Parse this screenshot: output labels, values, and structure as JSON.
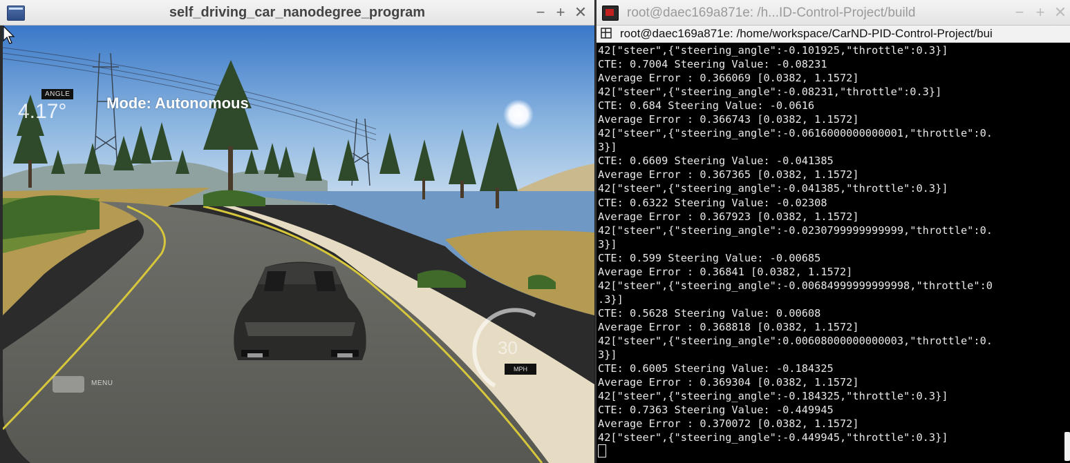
{
  "simulator": {
    "title": "self_driving_car_nanodegree_program",
    "controls": {
      "minimize": "−",
      "maximize": "+",
      "close": "✕"
    },
    "hud": {
      "angle_label": "ANGLE",
      "angle_value": "4.17°",
      "mode": "Mode: Autonomous",
      "menu_label": "MENU",
      "speed_value": "30",
      "speed_unit": "MPH"
    }
  },
  "terminal": {
    "title": "root@daec169a871e: /h...ID-Control-Project/build",
    "controls": {
      "minimize": "−",
      "maximize": "+",
      "close": "✕"
    },
    "tab_label": "root@daec169a871e: /home/workspace/CarND-PID-Control-Project/bui",
    "lines": [
      "42[\"steer\",{\"steering_angle\":-0.101925,\"throttle\":0.3}]",
      "CTE: 0.7004 Steering Value: -0.08231",
      "Average Error : 0.366069 [0.0382, 1.1572]",
      "42[\"steer\",{\"steering_angle\":-0.08231,\"throttle\":0.3}]",
      "CTE: 0.684 Steering Value: -0.0616",
      "Average Error : 0.366743 [0.0382, 1.1572]",
      "42[\"steer\",{\"steering_angle\":-0.0616000000000001,\"throttle\":0.",
      "3}]",
      "CTE: 0.6609 Steering Value: -0.041385",
      "Average Error : 0.367365 [0.0382, 1.1572]",
      "42[\"steer\",{\"steering_angle\":-0.041385,\"throttle\":0.3}]",
      "CTE: 0.6322 Steering Value: -0.02308",
      "Average Error : 0.367923 [0.0382, 1.1572]",
      "42[\"steer\",{\"steering_angle\":-0.0230799999999999,\"throttle\":0.",
      "3}]",
      "CTE: 0.599 Steering Value: -0.00685",
      "Average Error : 0.36841 [0.0382, 1.1572]",
      "42[\"steer\",{\"steering_angle\":-0.00684999999999998,\"throttle\":0",
      ".3}]",
      "CTE: 0.5628 Steering Value: 0.00608",
      "Average Error : 0.368818 [0.0382, 1.1572]",
      "42[\"steer\",{\"steering_angle\":0.00608000000000003,\"throttle\":0.",
      "3}]",
      "CTE: 0.6005 Steering Value: -0.184325",
      "Average Error : 0.369304 [0.0382, 1.1572]",
      "42[\"steer\",{\"steering_angle\":-0.184325,\"throttle\":0.3}]",
      "CTE: 0.7363 Steering Value: -0.449945",
      "Average Error : 0.370072 [0.0382, 1.1572]",
      "42[\"steer\",{\"steering_angle\":-0.449945,\"throttle\":0.3}]"
    ]
  }
}
